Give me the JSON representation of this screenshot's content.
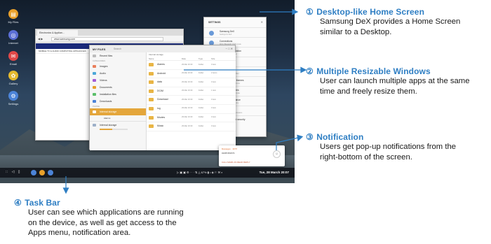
{
  "desktop": {
    "icons": [
      {
        "label": "My Files",
        "color": "#e8a02b",
        "glyph": "▤"
      },
      {
        "label": "Internet",
        "color": "#5b6fd6",
        "glyph": "◎"
      },
      {
        "label": "Email",
        "color": "#e04848",
        "glyph": "✉"
      },
      {
        "label": "Gallery",
        "color": "#e5b92e",
        "glyph": "✿"
      },
      {
        "label": "Settings",
        "color": "#4c84d8",
        "glyph": "⚙"
      }
    ]
  },
  "browser": {
    "tab": "Electronics & Applian...",
    "url": "www.samsung.com",
    "banner": "IMPORTANT INFORMATION",
    "menu": "MOBILE  TV & AUDIO  COMPUTING  APPLIANCES"
  },
  "files": {
    "title": "MY FILES",
    "search": "Search",
    "sidebar_top": [
      "Recent files"
    ],
    "categories_header": "CATEGORIES",
    "categories": [
      "Images",
      "Audio",
      "Videos",
      "Documents",
      "Installation files",
      "Downloads"
    ],
    "phone_header": "PHONE",
    "storage": [
      "Internal storage"
    ],
    "sub_storage": "Alarms",
    "footer_storage": "Internal storage",
    "path": "Internal storage",
    "columns": [
      "Name",
      "Date",
      "Type",
      "Size"
    ],
    "rows": [
      {
        "name": "Alarms",
        "date": "29 Mar 16:30",
        "type": "Folder",
        "size": "0 item"
      },
      {
        "name": "Android",
        "date": "29 Mar 16:30",
        "type": "Folder",
        "size": "2 items"
      },
      {
        "name": "data",
        "date": "29 Mar 16:30",
        "type": "Folder",
        "size": "0 item"
      },
      {
        "name": "DCIM",
        "date": "29 Mar 16:30",
        "type": "Folder",
        "size": "1 item"
      },
      {
        "name": "Download",
        "date": "29 Mar 16:30",
        "type": "Folder",
        "size": "0 item"
      },
      {
        "name": "log",
        "date": "29 Mar 16:30",
        "type": "Folder",
        "size": "0 item"
      },
      {
        "name": "Movies",
        "date": "29 Mar 16:30",
        "type": "Folder",
        "size": "0 item"
      },
      {
        "name": "Music",
        "date": "29 Mar 16:30",
        "type": "Folder",
        "size": "0 item"
      }
    ]
  },
  "settings": {
    "title": "SETTINGS",
    "items": [
      {
        "title": "Samsung DeX",
        "desc": "Settings for DeX"
      },
      {
        "title": "Connections",
        "desc": "Wi-Fi, Bluetooth, Flight mode"
      },
      {
        "title": "Sounds and vibration",
        "desc": "Sound mode, Ringtone"
      },
      {
        "title": "Notifications",
        "desc": "Block, allow, prioritise"
      },
      {
        "title": "Display",
        "desc": "Brightness, Blue light filter"
      },
      {
        "title": "Wallpapers and themes",
        "desc": "Wallpapers, Themes, Icons"
      },
      {
        "title": "Advanced features",
        "desc": "Games, One-handed mode"
      },
      {
        "title": "Device maintenance",
        "desc": "Battery, Storage, Memory"
      },
      {
        "title": "Apps",
        "desc": "Default apps, App permissions"
      },
      {
        "title": "Lock screen and security",
        "desc": "Always On Display"
      }
    ]
  },
  "notification": {
    "app": "Messages · 19:57",
    "body": "01087451573",
    "actions": "CALL    MARK AS READ    REPLY"
  },
  "taskbar": {
    "left_icons": "∷ ◁ ▯",
    "app_colors": [
      "#4c84d8",
      "#e8a02b",
      "#4c84d8"
    ],
    "status": "▷ ▣ ▣ ⚙ · · · ⇅ △ 67% ▮ • ◈ ⚐ ⚒ ⌕",
    "clock": "Tue, 28 March 20:07"
  },
  "annotations": [
    {
      "num": "①",
      "title": "Desktop-like Home Screen",
      "desc": [
        "Samsung DeX provides a Home Screen",
        "similar to a Desktop."
      ]
    },
    {
      "num": "②",
      "title": "Multiple Resizable Windows",
      "desc": [
        "User can launch multiple apps at the same",
        "time and freely resize them."
      ]
    },
    {
      "num": "③",
      "title": "Notification",
      "desc": [
        "Users get pop-up notifications from the",
        "right-bottom of the screen."
      ]
    },
    {
      "num": "④",
      "title": "Task Bar",
      "desc": [
        "User can see which applications are running",
        "on the device, as well as get access to the",
        "Apps menu, notification area."
      ]
    }
  ],
  "colors": {
    "accent": "#2e7ec3",
    "selection": "#e4a63b"
  }
}
